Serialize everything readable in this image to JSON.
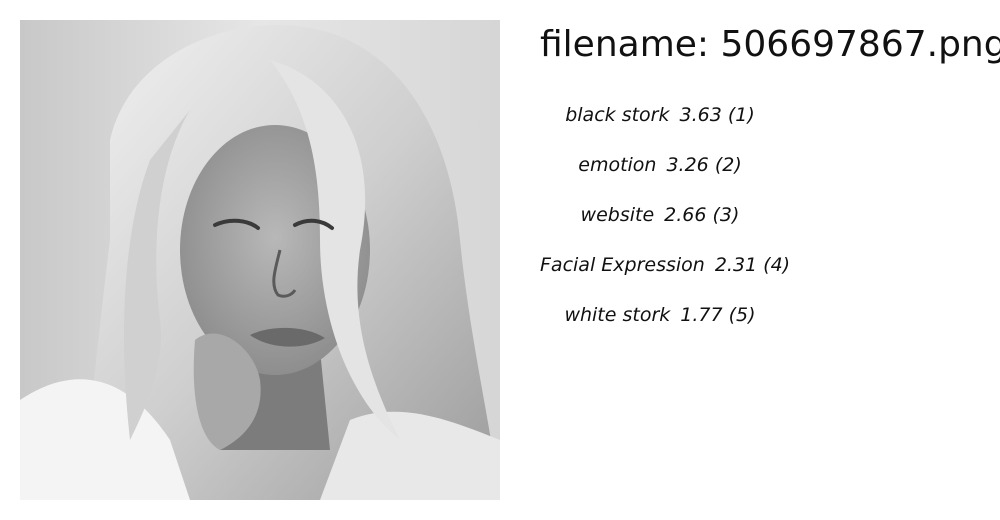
{
  "header": {
    "filename_text": "filename: 506697867.png"
  },
  "image": {
    "subject": "grayscale photo of a young woman with long blonde hair, head tilted, hand near chin, looking down"
  },
  "predictions": [
    {
      "name": "black stork",
      "score": "3.63",
      "rank": "(1)"
    },
    {
      "name": "emotion",
      "score": "3.26",
      "rank": "(2)"
    },
    {
      "name": "website",
      "score": "2.66",
      "rank": "(3)"
    },
    {
      "name": "Facial Expression",
      "score": "2.31",
      "rank": "(4)"
    },
    {
      "name": "white stork",
      "score": "1.77",
      "rank": "(5)"
    }
  ]
}
